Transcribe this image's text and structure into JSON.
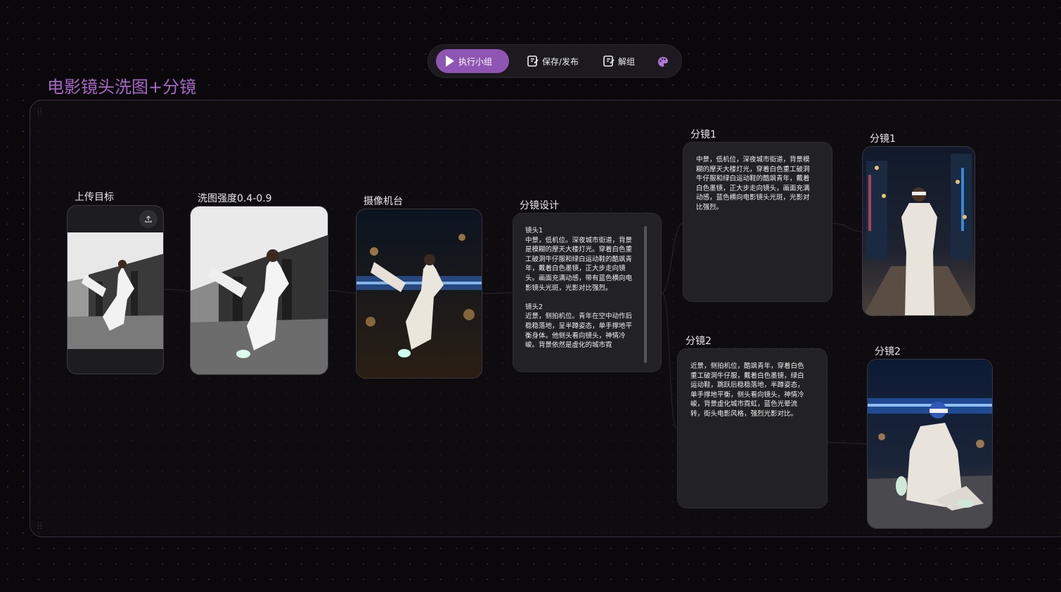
{
  "toolbar": {
    "run_label": "执行小组",
    "save_label": "保存/发布",
    "ungroup_label": "解组"
  },
  "group": {
    "title": "电影镜头洗图+分镜"
  },
  "nodes": {
    "upload": {
      "label": "上传目标"
    },
    "wash": {
      "label": "洗图强度0.4-0.9"
    },
    "camera": {
      "label": "摄像机台"
    },
    "design": {
      "label": "分镜设计",
      "text": "镜头1\n中景，低机位。深夜城市街道，背景是模糊的摩天大楼灯光。穿着白色重工破洞牛仔服和绿白运动鞋的酷飒青年，戴着白色墨镜，正大步走向镜头。画面充满动感，带有蓝色横向电影镜头光斑，光影对比强烈。\n\n镜头2\n近景，侧拍机位。青年在空中动作后稳稳落地，呈半蹲姿态，单手撑地平衡身体。他侧头看向镜头，神情冷峻。背景依然是虚化的城市霓"
    },
    "shot1_text": {
      "label": "分镜1",
      "text": "中景，低机位，深夜城市街道，背景模糊的摩天大楼灯光，穿着白色重工破洞牛仔服和绿白运动鞋的酷飒青年，戴着白色墨镜，正大步走向镜头，画面充满动感，蓝色横向电影镜头光斑，光影对比强烈。"
    },
    "shot1_image": {
      "label": "分镜1"
    },
    "shot2_text": {
      "label": "分镜2",
      "text": "近景，侧拍机位，酷飒青年，穿着白色重工破洞牛仔服，戴着白色墨镜，绿白运动鞋，跳跃后稳稳落地，半蹲姿态，单手撑地平衡，侧头看向镜头，神情冷峻，背景虚化城市霓虹，蓝色光晕流转，街头电影风格，强烈光影对比。"
    },
    "shot2_image": {
      "label": "分镜2"
    }
  },
  "colors": {
    "accent": "#8e55b5",
    "title": "#a966c8",
    "background": "#0a080b"
  }
}
